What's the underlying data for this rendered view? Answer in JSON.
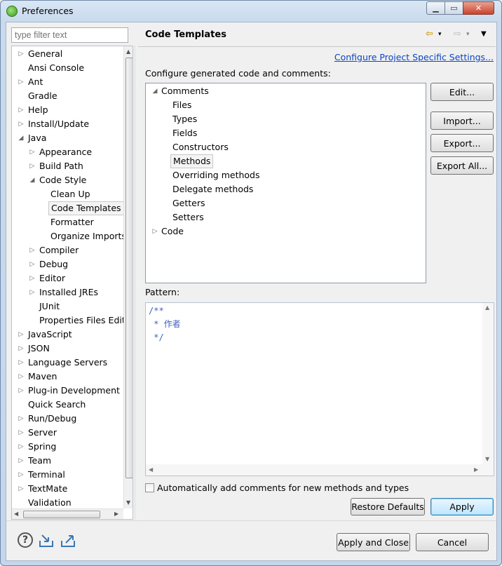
{
  "window": {
    "title": "Preferences",
    "min_glyph": "▁",
    "max_glyph": "▭",
    "close_glyph": "✕"
  },
  "sidebar": {
    "filter_placeholder": "type filter text",
    "items": [
      {
        "label": "General",
        "twisty": "▷"
      },
      {
        "label": "Ansi Console",
        "twisty": ""
      },
      {
        "label": "Ant",
        "twisty": "▷"
      },
      {
        "label": "Gradle",
        "twisty": ""
      },
      {
        "label": "Help",
        "twisty": "▷"
      },
      {
        "label": "Install/Update",
        "twisty": "▷"
      },
      {
        "label": "Java",
        "twisty": "◢"
      },
      {
        "label": "Appearance",
        "twisty": "▷"
      },
      {
        "label": "Build Path",
        "twisty": "▷"
      },
      {
        "label": "Code Style",
        "twisty": "◢"
      },
      {
        "label": "Clean Up",
        "twisty": ""
      },
      {
        "label": "Code Templates",
        "twisty": ""
      },
      {
        "label": "Formatter",
        "twisty": ""
      },
      {
        "label": "Organize Imports",
        "twisty": ""
      },
      {
        "label": "Compiler",
        "twisty": "▷"
      },
      {
        "label": "Debug",
        "twisty": "▷"
      },
      {
        "label": "Editor",
        "twisty": "▷"
      },
      {
        "label": "Installed JREs",
        "twisty": "▷"
      },
      {
        "label": "JUnit",
        "twisty": ""
      },
      {
        "label": "Properties Files Editor",
        "twisty": ""
      },
      {
        "label": "JavaScript",
        "twisty": "▷"
      },
      {
        "label": "JSON",
        "twisty": "▷"
      },
      {
        "label": "Language Servers",
        "twisty": "▷"
      },
      {
        "label": "Maven",
        "twisty": "▷"
      },
      {
        "label": "Plug-in Development",
        "twisty": "▷"
      },
      {
        "label": "Quick Search",
        "twisty": ""
      },
      {
        "label": "Run/Debug",
        "twisty": "▷"
      },
      {
        "label": "Server",
        "twisty": "▷"
      },
      {
        "label": "Spring",
        "twisty": "▷"
      },
      {
        "label": "Team",
        "twisty": "▷"
      },
      {
        "label": "Terminal",
        "twisty": "▷"
      },
      {
        "label": "TextMate",
        "twisty": "▷"
      },
      {
        "label": "Validation",
        "twisty": ""
      }
    ],
    "selected": "Code Templates"
  },
  "page": {
    "title": "Code Templates",
    "back_glyph": "⇦",
    "forward_glyph": "⇨",
    "dropdown_glyph": "▾",
    "menu_glyph": "▼",
    "configure_link": "Configure Project Specific Settings...",
    "configure_label": "Configure generated code and comments:",
    "templates": [
      {
        "label": "Comments",
        "twisty": "◢"
      },
      {
        "label": "Files",
        "twisty": ""
      },
      {
        "label": "Types",
        "twisty": ""
      },
      {
        "label": "Fields",
        "twisty": ""
      },
      {
        "label": "Constructors",
        "twisty": ""
      },
      {
        "label": "Methods",
        "twisty": ""
      },
      {
        "label": "Overriding methods",
        "twisty": ""
      },
      {
        "label": "Delegate methods",
        "twisty": ""
      },
      {
        "label": "Getters",
        "twisty": ""
      },
      {
        "label": "Setters",
        "twisty": ""
      },
      {
        "label": "Code",
        "twisty": "▷"
      }
    ],
    "selected_template": "Methods",
    "buttons": {
      "edit": "Edit...",
      "import": "Import...",
      "export": "Export...",
      "export_all": "Export All..."
    },
    "pattern_label": "Pattern:",
    "pattern_text": "/**\n * 作者\n */",
    "auto_comment_label": "Automatically add comments for new methods and types",
    "restore_defaults": "Restore Defaults",
    "apply": "Apply"
  },
  "footer": {
    "apply_and_close": "Apply and Close",
    "cancel": "Cancel",
    "help_glyph": "?"
  },
  "colors": {
    "link": "#0b44c4",
    "pattern_text": "#3f5fbf",
    "selection_border": "#c8c8c8"
  }
}
